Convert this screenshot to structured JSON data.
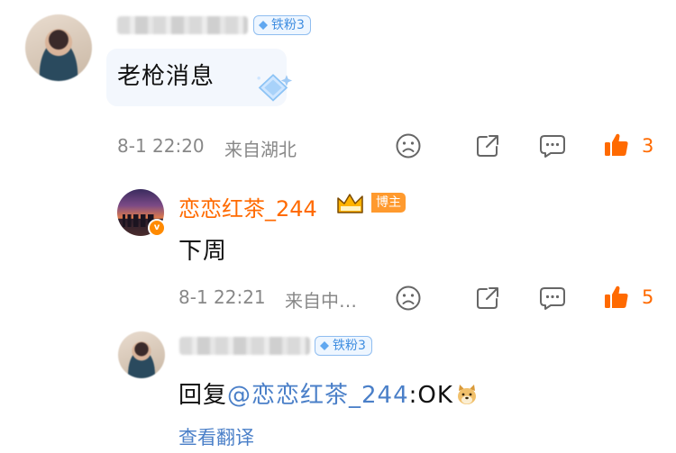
{
  "comments": [
    {
      "fan_badge": "铁粉3",
      "text": "老枪消息",
      "time": "8-1 22:20",
      "location": "来自湖北",
      "likes": "3"
    },
    {
      "username": "恋恋红茶_244",
      "role_badge": "博主",
      "verified_mark": "v",
      "text": "下周",
      "time": "8-1 22:21",
      "location": "来自中…",
      "likes": "5"
    },
    {
      "fan_badge": "铁粉3",
      "reply_prefix": "回复",
      "mention": "@恋恋红茶_244",
      "reply_text": ":OK",
      "translate_link": "查看翻译"
    }
  ],
  "icons": {
    "dislike": "frown-face-icon",
    "share": "share-icon",
    "comment": "comment-bubble-icon",
    "like": "thumbs-up-icon",
    "diamond": "diamond-icon",
    "crown": "crown-icon",
    "doge": "doge-emoji-icon"
  },
  "colors": {
    "accent": "#ff6a00",
    "link": "#4a7fc8",
    "fan_badge": "#3f8de0",
    "meta": "#888888"
  }
}
